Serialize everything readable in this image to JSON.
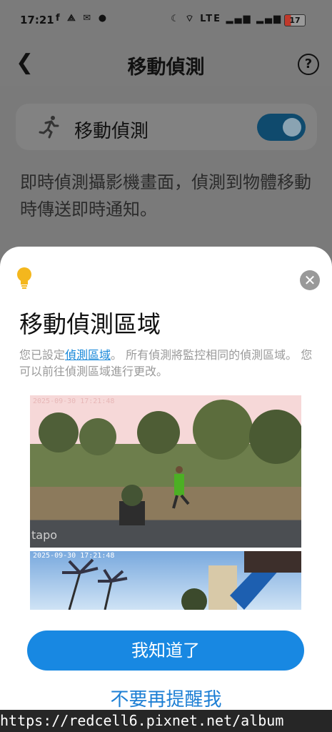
{
  "status_bar": {
    "time": "17:21",
    "left_icons": "f ⟁ ✉ ●",
    "right_icons": "☾ ⌔ LTE ▂▄▆ ▂▄▆",
    "battery": "17"
  },
  "header": {
    "title": "移動偵測",
    "help": "?"
  },
  "motion_card": {
    "label": "移動偵測",
    "enabled": true
  },
  "description": "即時偵測攝影機畫面，偵測到物體移動時傳送即時通知。",
  "sheet": {
    "title": "移動偵測區域",
    "body_prefix": "您已設定",
    "body_link": "偵測區域",
    "body_suffix": "。 所有偵測將監控相同的偵測區域。 您可以前往偵測區域進行更改。",
    "preview": {
      "timestamp_top": "2025-09-30 17:21:48",
      "timestamp_bottom": "2025-09-30 17:21:48",
      "brand": "tapo"
    },
    "primary_button": "我知道了",
    "secondary_button": "不要再提醒我"
  },
  "watermark": "https://redcell6.pixnet.net/album"
}
